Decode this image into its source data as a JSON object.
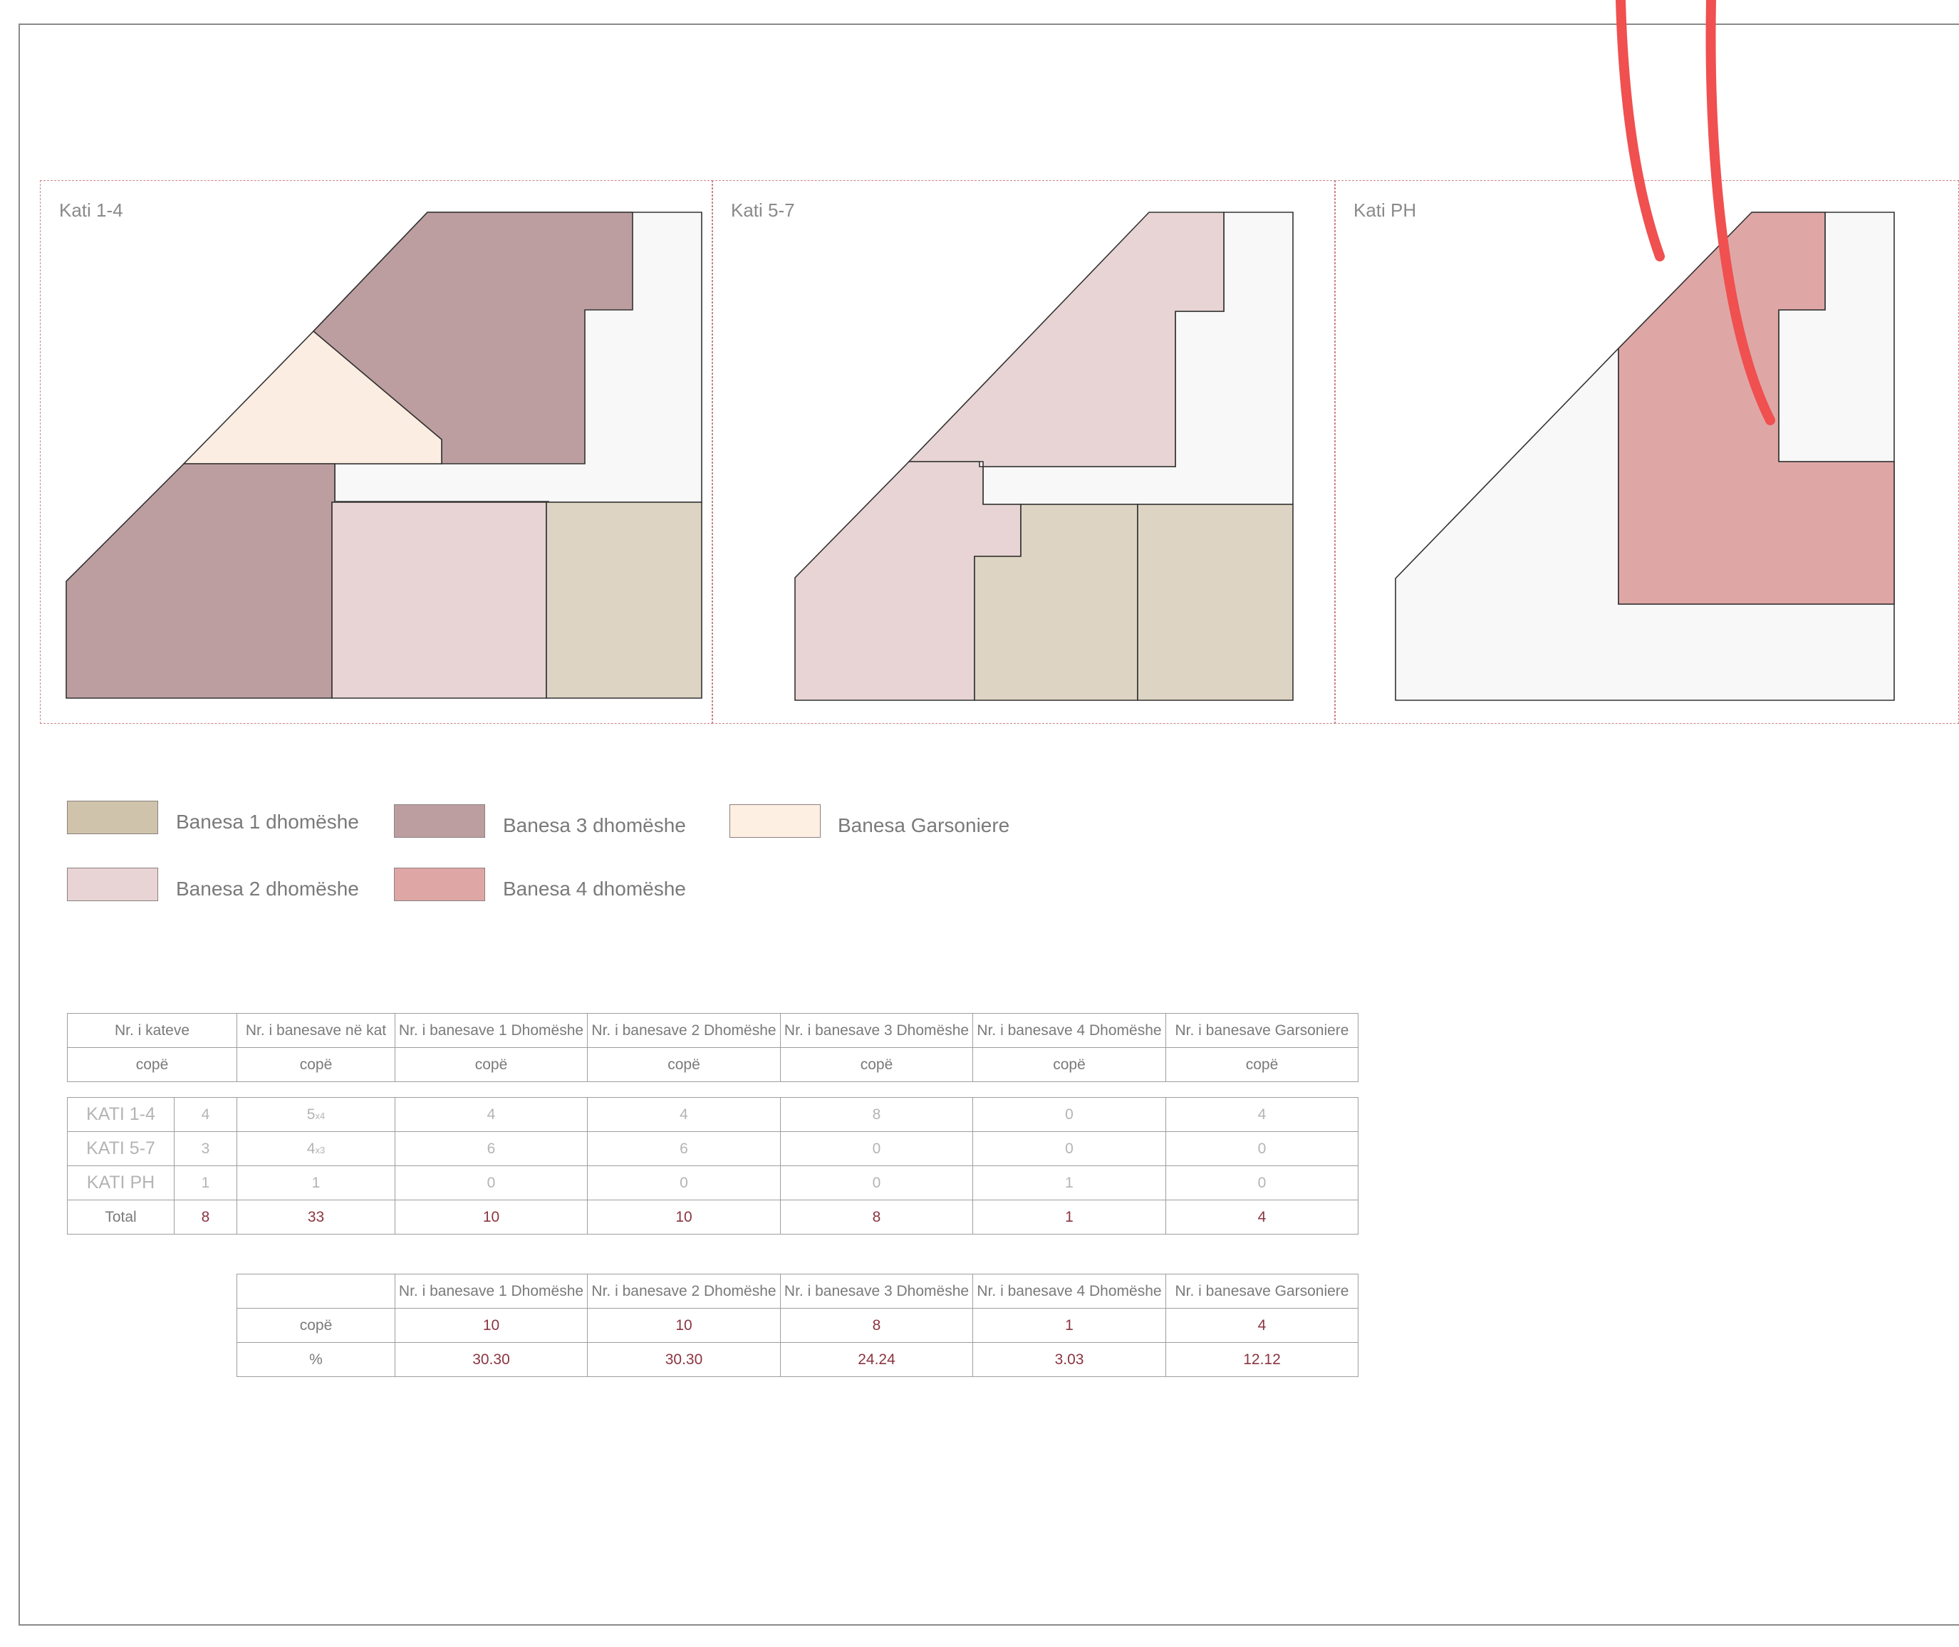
{
  "colors": {
    "banesa_1": "#ddd4c3",
    "banesa_2": "#e8d4d4",
    "banesa_3": "#bd9ea0",
    "banesa_4": "#dea7a6",
    "garsoniere": "#fbede1",
    "common": "#f8f8f8",
    "panel_border": "#c9858b",
    "annotation": "#f05050",
    "accent_text": "#8b3540"
  },
  "panels": [
    {
      "label": "Kati 1-4"
    },
    {
      "label": "Kati 5-7"
    },
    {
      "label": "Kati PH"
    }
  ],
  "legend": [
    {
      "label": "Banesa 1 dhomëshe",
      "color": "#cfc3ab"
    },
    {
      "label": "Banesa 3 dhomëshe",
      "color": "#bd9ea0"
    },
    {
      "label": "Banesa Garsoniere",
      "color": "#fdf0e3"
    },
    {
      "label": "Banesa 2 dhomëshe",
      "color": "#e8d4d4"
    },
    {
      "label": "Banesa 4 dhomëshe",
      "color": "#dea7a6"
    }
  ],
  "table1": {
    "headers": [
      "Nr. i kateve",
      "Nr. i banesave në kat",
      "Nr. i banesave 1 Dhomëshe",
      "Nr. i banesave 2 Dhomëshe",
      "Nr. i banesave 3 Dhomëshe",
      "Nr. i banesave 4 Dhomëshe",
      "Nr. i banesave Garsoniere"
    ],
    "units": [
      "copë",
      "copë",
      "copë",
      "copë",
      "copë",
      "copë",
      "copë"
    ],
    "rows": [
      {
        "name": "KATI 1-4",
        "floors": "4",
        "per_floor": "5",
        "per_floor_sub": "x4",
        "b1": "4",
        "b2": "4",
        "b3": "8",
        "b4": "0",
        "g": "4"
      },
      {
        "name": "KATI 5-7",
        "floors": "3",
        "per_floor": "4",
        "per_floor_sub": "x3",
        "b1": "6",
        "b2": "6",
        "b3": "0",
        "b4": "0",
        "g": "0"
      },
      {
        "name": "KATI PH",
        "floors": "1",
        "per_floor": "1",
        "per_floor_sub": "",
        "b1": "0",
        "b2": "0",
        "b3": "0",
        "b4": "1",
        "g": "0"
      }
    ],
    "total": {
      "name": "Total",
      "floors": "8",
      "per_floor": "33",
      "b1": "10",
      "b2": "10",
      "b3": "8",
      "b4": "1",
      "g": "4"
    }
  },
  "table2": {
    "headers": [
      "Nr. i banesave 1 Dhomëshe",
      "Nr. i banesave 2 Dhomëshe",
      "Nr. i banesave 3 Dhomëshe",
      "Nr. i banesave 4 Dhomëshe",
      "Nr. i banesave Garsoniere"
    ],
    "rows": [
      {
        "label": "copë",
        "values": [
          "10",
          "10",
          "8",
          "1",
          "4"
        ]
      },
      {
        "label": "%",
        "values": [
          "30.30",
          "30.30",
          "24.24",
          "3.03",
          "12.12"
        ]
      }
    ]
  }
}
